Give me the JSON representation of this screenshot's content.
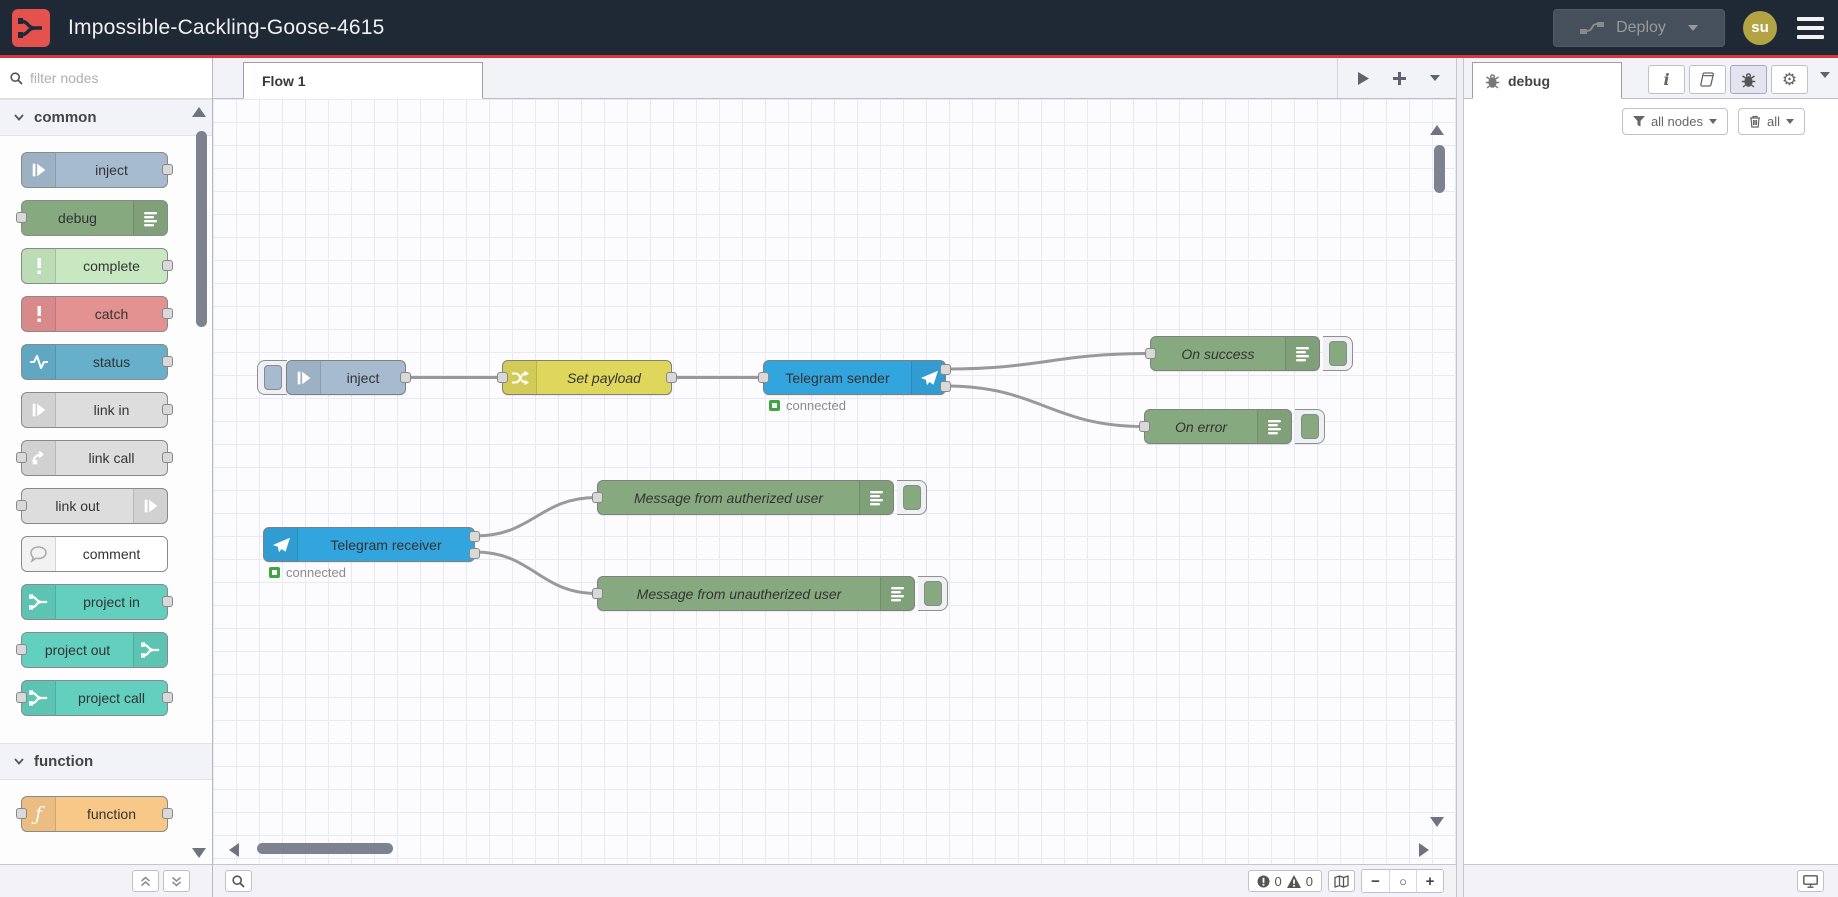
{
  "header": {
    "title": "Impossible-Cackling-Goose-4615",
    "deploy_label": "Deploy",
    "user_initials": "su"
  },
  "palette": {
    "search_placeholder": "filter nodes",
    "categories": [
      {
        "label": "common",
        "items": [
          {
            "label": "inject",
            "color": "#a6bbcf",
            "icon": "inject-arrow-icon"
          },
          {
            "label": "debug",
            "color": "#87a980",
            "icon": "debug-list-icon"
          },
          {
            "label": "complete",
            "color": "#c7e8c0",
            "icon": "exclamation-icon"
          },
          {
            "label": "catch",
            "color": "#e49191",
            "icon": "exclamation-icon"
          },
          {
            "label": "status",
            "color": "#66b0cc",
            "icon": "pulse-icon"
          },
          {
            "label": "link in",
            "color": "#dddddd",
            "icon": "link-arrow-icon"
          },
          {
            "label": "link call",
            "color": "#dddddd",
            "icon": "link-arrow-icon"
          },
          {
            "label": "link out",
            "color": "#dddddd",
            "icon": "link-arrow-icon"
          },
          {
            "label": "comment",
            "color": "#ffffff",
            "icon": "speech-bubble-icon"
          },
          {
            "label": "project in",
            "color": "#63cfbe",
            "icon": "node-red-merge-icon"
          },
          {
            "label": "project out",
            "color": "#63cfbe",
            "icon": "node-red-merge-icon"
          },
          {
            "label": "project call",
            "color": "#63cfbe",
            "icon": "node-red-merge-icon"
          }
        ]
      },
      {
        "label": "function",
        "items": [
          {
            "label": "function",
            "color": "#f8c889",
            "icon": "function-f-icon"
          }
        ]
      }
    ]
  },
  "workspace": {
    "tab_label": "Flow 1",
    "flow": {
      "inject": {
        "label": "inject",
        "color": "#a6bbcf"
      },
      "set_payload": {
        "label": "Set payload",
        "color": "#dfd65c"
      },
      "telegram_sender": {
        "label": "Telegram sender",
        "color": "#33a5de",
        "status": "connected"
      },
      "on_success": {
        "label": "On success",
        "color": "#87a980"
      },
      "on_error": {
        "label": "On error",
        "color": "#87a980"
      },
      "telegram_receiver": {
        "label": "Telegram receiver",
        "color": "#33a5de",
        "status": "connected"
      },
      "msg_authorized": {
        "label": "Message from autherized user",
        "color": "#87a980"
      },
      "msg_unauthorized": {
        "label": "Message from unautherized user",
        "color": "#87a980"
      }
    },
    "footer": {
      "error_count": "0",
      "warning_count": "0",
      "zoom_out": "−",
      "zoom_reset": "○",
      "zoom_in": "+"
    }
  },
  "sidebar": {
    "tab_label": "debug",
    "filter_label": "all nodes",
    "clear_label": "all"
  },
  "colors": {
    "header_bg": "#1f2936",
    "accent_red": "#d9363e",
    "logo_red": "#e5514d",
    "status_green": "#3fa540",
    "wire_gray": "#999999",
    "avatar_olive": "#b2a343"
  }
}
